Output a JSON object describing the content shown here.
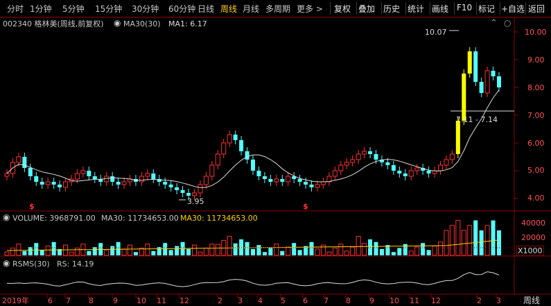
{
  "toolbar": {
    "tabs": [
      "分时",
      "1分钟",
      "5分钟",
      "15分钟",
      "30分钟",
      "60分钟",
      "日线",
      "周线",
      "月线",
      "多周期",
      "更多 >"
    ],
    "active_tab": "周线",
    "right_buttons": [
      "复权",
      "叠加",
      "历史",
      "统计",
      "画线",
      "F10",
      "标记",
      "+自选",
      "返回"
    ]
  },
  "main_panel": {
    "stock_label": "002340 格林美(周线,前复权)",
    "ma_label": "MA30(30)",
    "ma1_label": "MA1: 6.17",
    "y_ticks": [
      "10.00",
      "9.00",
      "8.00",
      "7.00",
      "6.00",
      "5.00",
      "4.00"
    ],
    "annotation_high": "10.07",
    "annotation_low": "3.95",
    "annotation_range": "7.11 - 7.14",
    "markers": [
      "$",
      "$"
    ]
  },
  "volume_panel": {
    "label": "VOLUME: 3968791.00",
    "ma30_label": "MA30: 11734653.00",
    "ma30_label_2": "MA30: 11734653.00",
    "y_ticks": [
      "40000",
      "20000"
    ],
    "unit": "X1000"
  },
  "rsms_panel": {
    "label": "RSMS(30)",
    "rs_label": "RS: 14.19"
  },
  "x_axis": {
    "labels": [
      "2019年",
      "6",
      "7",
      "8",
      "9",
      "10",
      "11",
      "12",
      "2",
      "3",
      "4",
      "5",
      "6",
      "7",
      "8",
      "9",
      "10",
      "11",
      "12",
      "2",
      "3"
    ],
    "period_label": "周线"
  },
  "colors": {
    "up": "#ff3333",
    "down": "#54ffff",
    "yellow": "#ffff00",
    "grid": "#8b0000",
    "ma": "#dcdcdc",
    "ma_volume": "#ffd200"
  }
}
